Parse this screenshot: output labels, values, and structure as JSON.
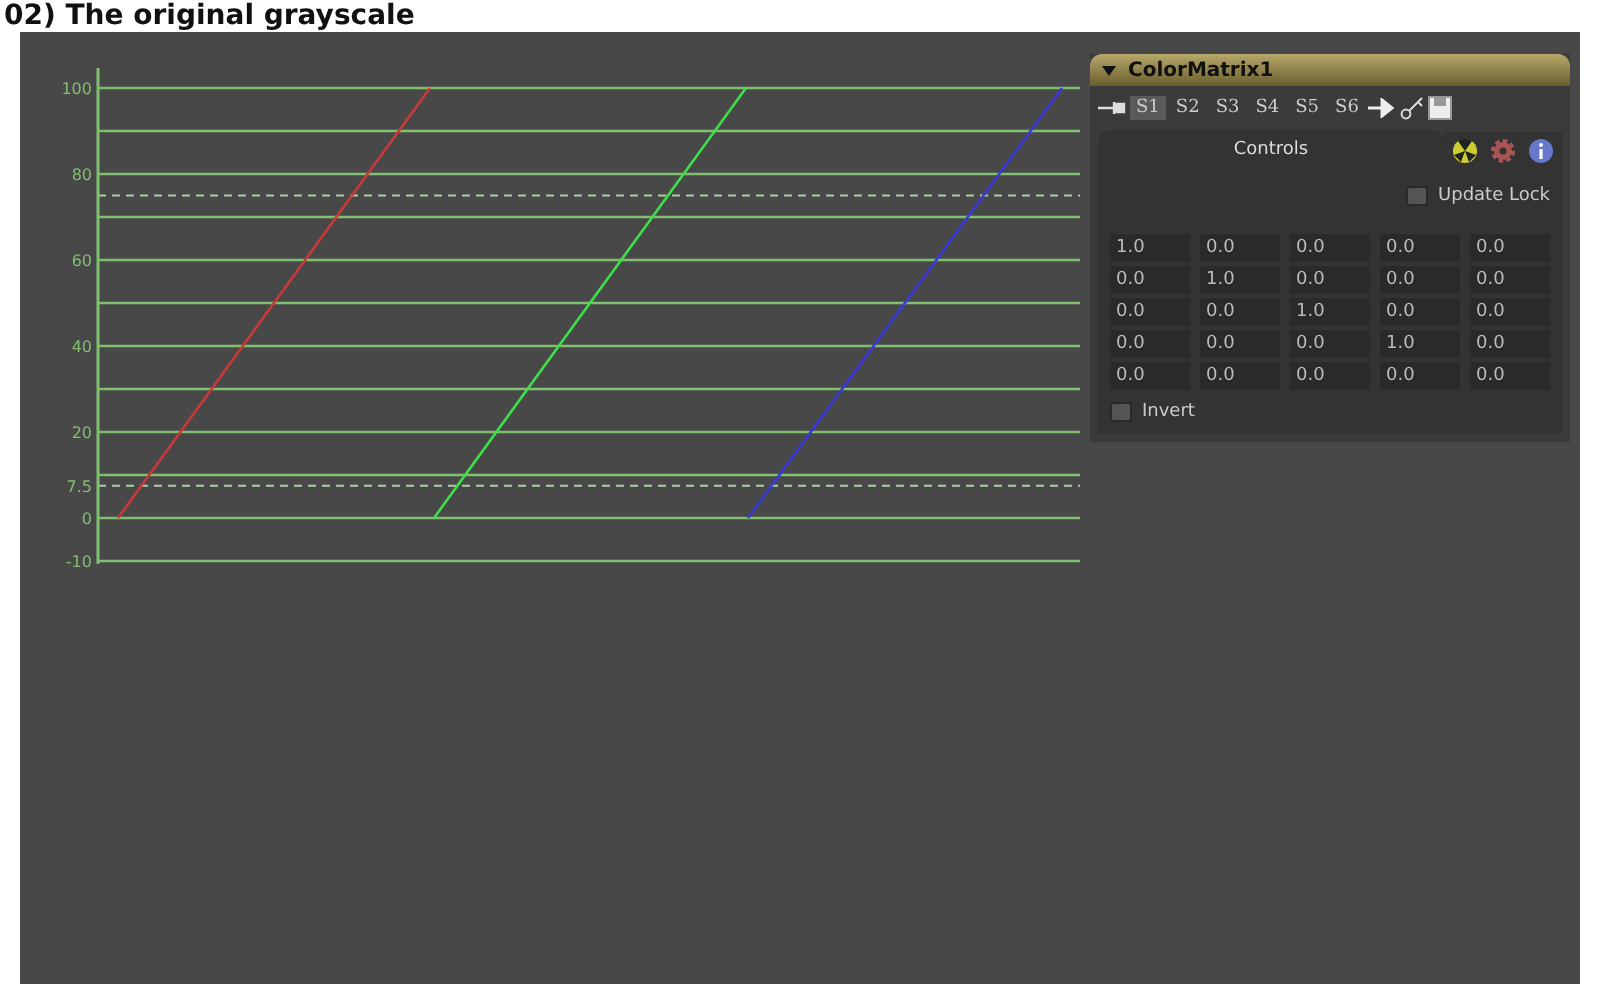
{
  "heading": "02) The original grayscale",
  "scope": {
    "y_labels": [
      "100",
      "80",
      "60",
      "40",
      "20",
      "7.5",
      "0",
      "-10"
    ]
  },
  "panel": {
    "title": "ColorMatrix1",
    "expanded": true,
    "slots": [
      {
        "label": "S1",
        "selected": true
      },
      {
        "label": "S2",
        "selected": false
      },
      {
        "label": "S3",
        "selected": false
      },
      {
        "label": "S4",
        "selected": false
      },
      {
        "label": "S5",
        "selected": false
      },
      {
        "label": "S6",
        "selected": false
      }
    ],
    "tabs": [
      {
        "label": "Controls",
        "selected": true
      }
    ],
    "update_lock": {
      "label": "Update Lock",
      "checked": false
    },
    "matrix": [
      [
        "1.0",
        "0.0",
        "0.0",
        "0.0",
        "0.0"
      ],
      [
        "0.0",
        "1.0",
        "0.0",
        "0.0",
        "0.0"
      ],
      [
        "0.0",
        "0.0",
        "1.0",
        "0.0",
        "0.0"
      ],
      [
        "0.0",
        "0.0",
        "0.0",
        "1.0",
        "0.0"
      ],
      [
        "0.0",
        "0.0",
        "0.0",
        "0.0",
        "0.0"
      ]
    ],
    "invert": {
      "label": "Invert",
      "checked": false
    }
  }
}
